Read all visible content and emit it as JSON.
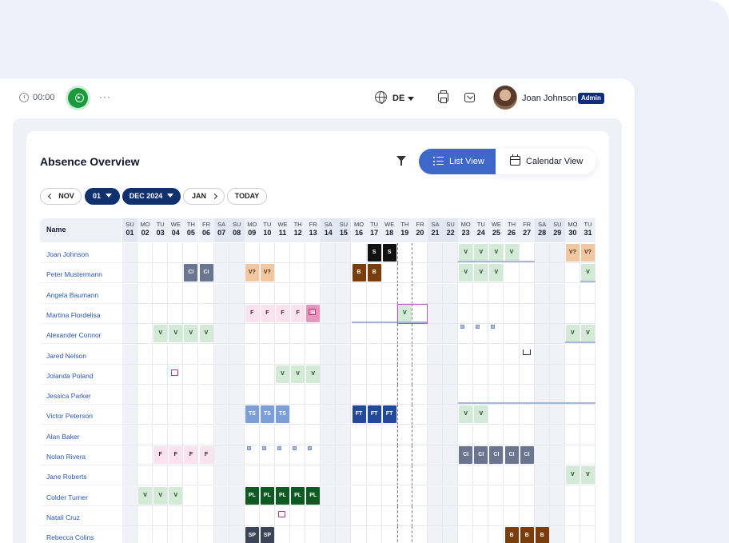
{
  "topbar": {
    "timer": "00:00",
    "more": "···",
    "lang": "DE",
    "user_name": "Joan Johnson",
    "role": "Admin"
  },
  "page": {
    "title": "Absence Overview",
    "list_view": "List View",
    "calendar_view": "Calendar View"
  },
  "nav": {
    "prev": "NOV",
    "day": "01",
    "month": "DEC 2024",
    "next": "JAN",
    "today": "TODAY"
  },
  "grid": {
    "name_header": "Name",
    "days": [
      {
        "d": "SU",
        "n": "01"
      },
      {
        "d": "MO",
        "n": "02"
      },
      {
        "d": "TU",
        "n": "03"
      },
      {
        "d": "WE",
        "n": "04"
      },
      {
        "d": "TH",
        "n": "05"
      },
      {
        "d": "FR",
        "n": "06"
      },
      {
        "d": "SA",
        "n": "07"
      },
      {
        "d": "SU",
        "n": "08"
      },
      {
        "d": "MO",
        "n": "09"
      },
      {
        "d": "TU",
        "n": "10"
      },
      {
        "d": "WE",
        "n": "11"
      },
      {
        "d": "TH",
        "n": "12"
      },
      {
        "d": "FR",
        "n": "13"
      },
      {
        "d": "SA",
        "n": "14"
      },
      {
        "d": "SU",
        "n": "15"
      },
      {
        "d": "MO",
        "n": "16"
      },
      {
        "d": "TU",
        "n": "17"
      },
      {
        "d": "WE",
        "n": "18"
      },
      {
        "d": "TH",
        "n": "19"
      },
      {
        "d": "FR",
        "n": "20"
      },
      {
        "d": "SA",
        "n": "21"
      },
      {
        "d": "SU",
        "n": "22"
      },
      {
        "d": "MO",
        "n": "23"
      },
      {
        "d": "TU",
        "n": "24"
      },
      {
        "d": "WE",
        "n": "25"
      },
      {
        "d": "TH",
        "n": "26"
      },
      {
        "d": "FR",
        "n": "27"
      },
      {
        "d": "SA",
        "n": "28"
      },
      {
        "d": "SU",
        "n": "29"
      },
      {
        "d": "MO",
        "n": "30"
      },
      {
        "d": "TU",
        "n": "31"
      }
    ],
    "employees": [
      "Joan Johnson",
      "Peter Mustermann",
      "Angela Baumann",
      "Martina Flordelisa",
      "Alexander Connor",
      "Jared Nelson",
      "Jolanda Poland",
      "Jessica Parker",
      "Victor Peterson",
      "Alan Baker",
      "Nolan Rivera",
      "Jane Roberts",
      "Colder Turner",
      "Natali Cruz",
      "Rebecca Colins"
    ],
    "absences": [
      {
        "row": 0,
        "days": [
          17,
          18
        ],
        "code": "S",
        "bg": "#111111",
        "fg": "#ffffff"
      },
      {
        "row": 0,
        "days": [
          23,
          24,
          25,
          26
        ],
        "code": "V",
        "bg": "#d3ead6",
        "fg": "#1b3a22"
      },
      {
        "row": 0,
        "days": [
          30,
          31
        ],
        "code": "V?",
        "bg": "#f1c7a2",
        "fg": "#4a2a10"
      },
      {
        "row": 1,
        "days": [
          5,
          6
        ],
        "code": "CI",
        "bg": "#6a7590",
        "fg": "#ffffff"
      },
      {
        "row": 1,
        "days": [
          9,
          10
        ],
        "code": "V?",
        "bg": "#f1c7a2",
        "fg": "#4a2a10"
      },
      {
        "row": 1,
        "days": [
          16,
          17
        ],
        "code": "B",
        "bg": "#7a3d0c",
        "fg": "#ffffff"
      },
      {
        "row": 1,
        "days": [
          23,
          24,
          25
        ],
        "code": "V",
        "bg": "#d3ead6",
        "fg": "#1b3a22"
      },
      {
        "row": 1,
        "days": [
          31
        ],
        "code": "V",
        "bg": "#d3ead6",
        "fg": "#1b3a22"
      },
      {
        "row": 3,
        "days": [
          9,
          10,
          11,
          12
        ],
        "code": "F",
        "bg": "#fbe3ee",
        "fg": "#3a1a28"
      },
      {
        "row": 3,
        "days": [
          13
        ],
        "code": "H",
        "bg": "#e995c0",
        "fg": "#ffffff"
      },
      {
        "row": 3,
        "days": [
          19
        ],
        "code": "V",
        "bg": "#d3ead6",
        "fg": "#1b3a22"
      },
      {
        "row": 4,
        "days": [
          3,
          4,
          5,
          6
        ],
        "code": "V",
        "bg": "#d3ead6",
        "fg": "#1b3a22"
      },
      {
        "row": 4,
        "days": [
          30,
          31
        ],
        "code": "V",
        "bg": "#d3ead6",
        "fg": "#1b3a22"
      },
      {
        "row": 6,
        "days": [
          11,
          12,
          13
        ],
        "code": "V",
        "bg": "#d3ead6",
        "fg": "#1b3a22"
      },
      {
        "row": 8,
        "days": [
          9,
          10,
          11
        ],
        "code": "TS",
        "bg": "#7d9fd8",
        "fg": "#ffffff"
      },
      {
        "row": 8,
        "days": [
          16,
          17,
          18
        ],
        "code": "FT",
        "bg": "#234a9a",
        "fg": "#ffffff"
      },
      {
        "row": 8,
        "days": [
          23,
          24
        ],
        "code": "V",
        "bg": "#d3ead6",
        "fg": "#1b3a22"
      },
      {
        "row": 10,
        "days": [
          3,
          4,
          5,
          6
        ],
        "code": "F",
        "bg": "#fbe3ee",
        "fg": "#3a1a28"
      },
      {
        "row": 10,
        "days": [
          23,
          24,
          25,
          26,
          27
        ],
        "code": "CI",
        "bg": "#6a7590",
        "fg": "#ffffff"
      },
      {
        "row": 11,
        "days": [
          30,
          31
        ],
        "code": "V",
        "bg": "#d3ead6",
        "fg": "#1b3a22"
      },
      {
        "row": 12,
        "days": [
          2,
          3,
          4
        ],
        "code": "V",
        "bg": "#d3ead6",
        "fg": "#1b3a22"
      },
      {
        "row": 12,
        "days": [
          9,
          10,
          11,
          12,
          13
        ],
        "code": "PL",
        "bg": "#0f5a22",
        "fg": "#ffffff"
      },
      {
        "row": 14,
        "days": [
          9,
          10
        ],
        "code": "SP",
        "bg": "#3c4458",
        "fg": "#ffffff"
      },
      {
        "row": 14,
        "days": [
          26,
          27,
          28
        ],
        "code": "B",
        "bg": "#7a3d0c",
        "fg": "#ffffff"
      }
    ]
  }
}
